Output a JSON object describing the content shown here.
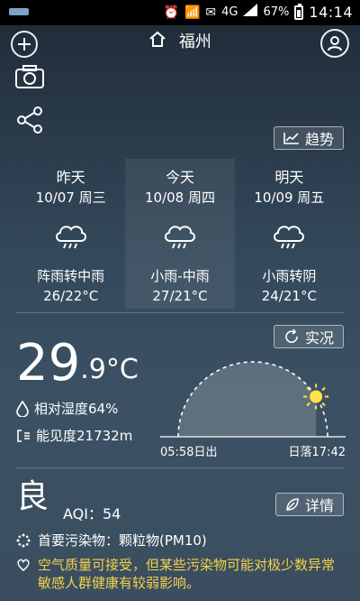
{
  "status_bar": {
    "network": "4G",
    "battery": "67%",
    "time": "14:14"
  },
  "header": {
    "city": "福州"
  },
  "buttons": {
    "trend": "趋势",
    "live": "实况",
    "detail": "详情"
  },
  "forecast": [
    {
      "name": "昨天",
      "date": "10/07 周三",
      "condition": "阵雨转中雨",
      "temp": "26/22°C"
    },
    {
      "name": "今天",
      "date": "10/08 周四",
      "condition": "小雨-中雨",
      "temp": "27/21°C"
    },
    {
      "name": "明天",
      "date": "10/09 周五",
      "condition": "小雨转阴",
      "temp": "24/21°C"
    }
  ],
  "current": {
    "temp_int": "29",
    "temp_dec": ".9°C",
    "humidity": "相对湿度64%",
    "visibility": "能见度21732m"
  },
  "sun": {
    "sunrise": "05:58日出",
    "sunset": "日落17:42",
    "progress": 0.82
  },
  "air": {
    "level": "良",
    "aqi": "AQI：54",
    "primary_pollutant": "首要污染物：颗粒物(PM10)",
    "advice": "空气质量可接受，但某些污染物可能对极少数异常敏感人群健康有较弱影响。"
  },
  "colors": {
    "advice_text": "#f3d24a",
    "sun": "#ffe14a"
  }
}
